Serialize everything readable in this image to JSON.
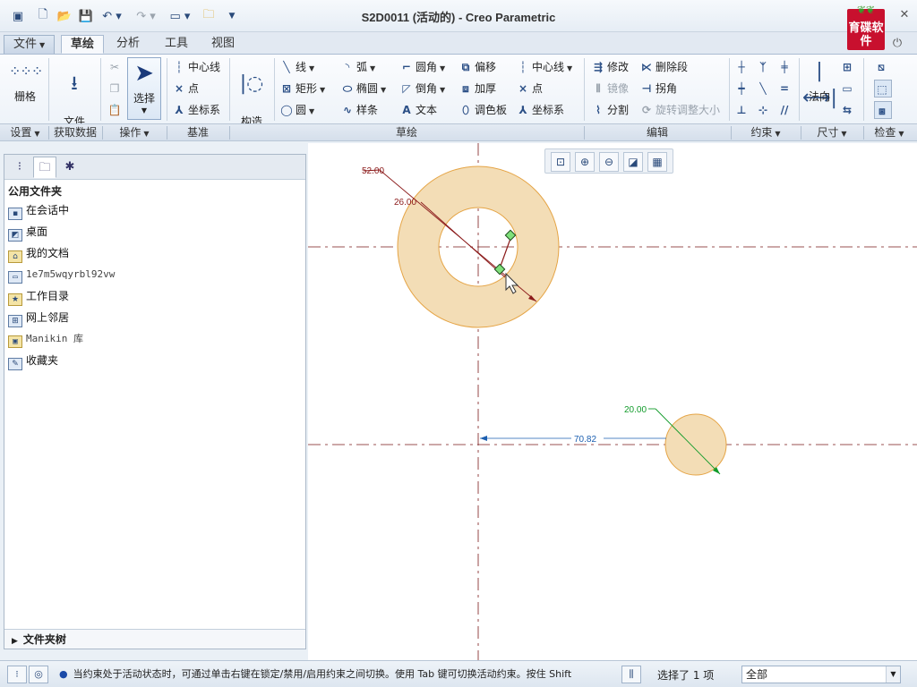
{
  "window": {
    "title": "S2D0011 (活动的) - Creo Parametric"
  },
  "logo": {
    "text": "育碟软件"
  },
  "tabs": [
    {
      "label": "文件"
    },
    {
      "label": "草绘"
    },
    {
      "label": "分析"
    },
    {
      "label": "工具"
    },
    {
      "label": "视图"
    }
  ],
  "ribbon": {
    "grid": "栅格",
    "file_system": "文件\n系统",
    "select": "选择",
    "construction_mode": "构造\n模式",
    "datum_centerline": "中心线",
    "datum_point": "点",
    "datum_csys": "坐标系",
    "line": "线",
    "rectangle": "矩形",
    "circle": "圆",
    "arc": "弧",
    "ellipse": "椭圆",
    "spline": "样条",
    "fillet": "圆角",
    "chamfer": "倒角",
    "text": "文本",
    "offset": "偏移",
    "thicken": "加厚",
    "palette": "调色板",
    "centerline": "中心线",
    "point": "点",
    "csys": "坐标系",
    "modify": "修改",
    "mirror": "镜像",
    "divide": "分割",
    "delete_segment": "删除段",
    "corner": "拐角",
    "rotate_resize": "旋转调整大小",
    "normal": "法向"
  },
  "groups": [
    {
      "label": "设置",
      "dropdown": true
    },
    {
      "label": "获取数据",
      "dropdown": false
    },
    {
      "label": "操作",
      "dropdown": true
    },
    {
      "label": "基准",
      "dropdown": false
    },
    {
      "label": "草绘",
      "dropdown": false
    },
    {
      "label": "编辑",
      "dropdown": false
    },
    {
      "label": "约束",
      "dropdown": true
    },
    {
      "label": "尺寸",
      "dropdown": true
    },
    {
      "label": "检查",
      "dropdown": true
    }
  ],
  "folder_browser": {
    "header": "公用文件夹",
    "items": [
      {
        "label": "在会话中",
        "icon": "session-icon"
      },
      {
        "label": "桌面",
        "icon": "desktop-icon"
      },
      {
        "label": "我的文档",
        "icon": "documents-icon"
      },
      {
        "label": "1e7m5wqyrbl92vw",
        "icon": "computer-icon"
      },
      {
        "label": "工作目录",
        "icon": "working-directory-icon"
      },
      {
        "label": "网上邻居",
        "icon": "network-icon"
      },
      {
        "label": "Manikin 库",
        "icon": "library-icon"
      },
      {
        "label": "收藏夹",
        "icon": "favorites-icon"
      }
    ],
    "tree_label": "文件夹树"
  },
  "sketch": {
    "dimensions": {
      "outer_diameter": "52.00",
      "inner_diameter": "26.00",
      "small_diameter": "20.00",
      "horizontal_distance": "70.82"
    },
    "colors": {
      "fill": "#f3ddb6",
      "outline": "#e5a445",
      "dimension": "#8b1a1a",
      "dimension_weak": "#119b2a",
      "dimension_blue": "#1c5fb0",
      "centerline": "#7a1a1a"
    }
  },
  "status": {
    "message": "当约束处于活动状态时，可通过单击右键在锁定/禁用/启用约束之间切换。使用 Tab 键可切换活动约束。按住 Shift",
    "selected": "选择了 1 项",
    "filter": "全部"
  }
}
